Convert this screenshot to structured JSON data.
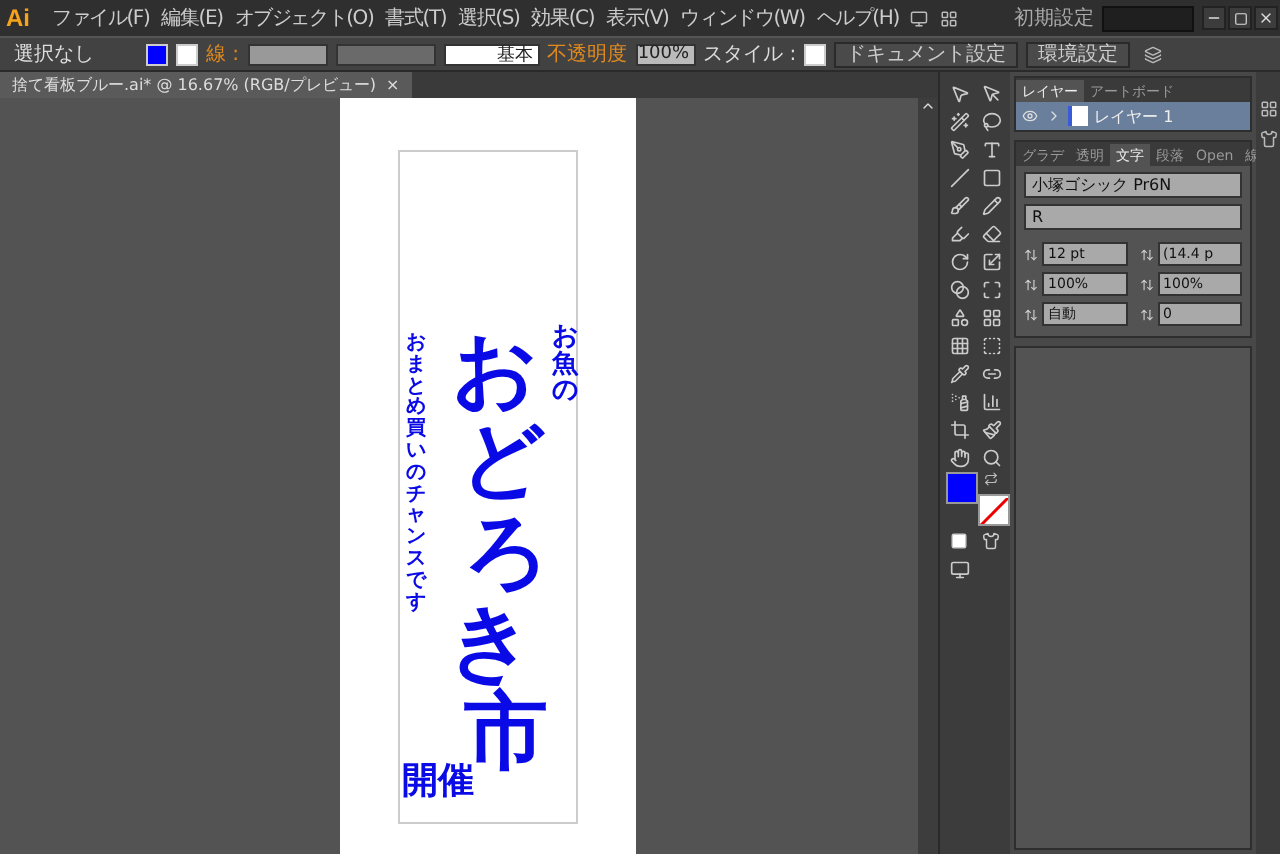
{
  "app": {
    "logo": "Ai"
  },
  "menu": [
    "ファイル(F)",
    "編集(E)",
    "オブジェクト(O)",
    "書式(T)",
    "選択(S)",
    "効果(C)",
    "表示(V)",
    "ウィンドウ(W)",
    "ヘルプ(H)"
  ],
  "workspace": {
    "label": "初期設定"
  },
  "control_bar": {
    "selection": "選択なし",
    "stroke_label": "線 :",
    "stroke_style": "基本",
    "opacity_label": "不透明度",
    "opacity": "100%",
    "style_label": "スタイル :",
    "buttons": [
      "ドキュメント設定",
      "環境設定"
    ]
  },
  "document_tab": {
    "title": "捨て看板ブルー.ai* @ 16.67% (RGB/プレビュー)",
    "close": "×"
  },
  "artboard": {
    "subtitle": "お魚の",
    "headline": "おどろき市",
    "tagline": "おまとめ買いのチャンスです",
    "footer": "開催"
  },
  "layers_panel": {
    "tabs": [
      {
        "label": "レイヤー",
        "selected": true
      },
      {
        "label": "アートボード",
        "selected": false
      }
    ],
    "layers": [
      {
        "name": "レイヤー 1",
        "visible": true
      }
    ]
  },
  "character_panel": {
    "tabs": [
      {
        "label": "グラデ",
        "selected": false
      },
      {
        "label": "透明",
        "selected": false
      },
      {
        "label": "文字",
        "selected": true
      },
      {
        "label": "段落",
        "selected": false
      },
      {
        "label": "Open",
        "selected": false
      },
      {
        "label": "線",
        "selected": false
      }
    ],
    "font": "小塚ゴシック Pr6N",
    "style": "R",
    "fields": [
      "12 pt",
      "(14.4 p",
      "100%",
      "100%",
      "自動",
      "0"
    ]
  }
}
